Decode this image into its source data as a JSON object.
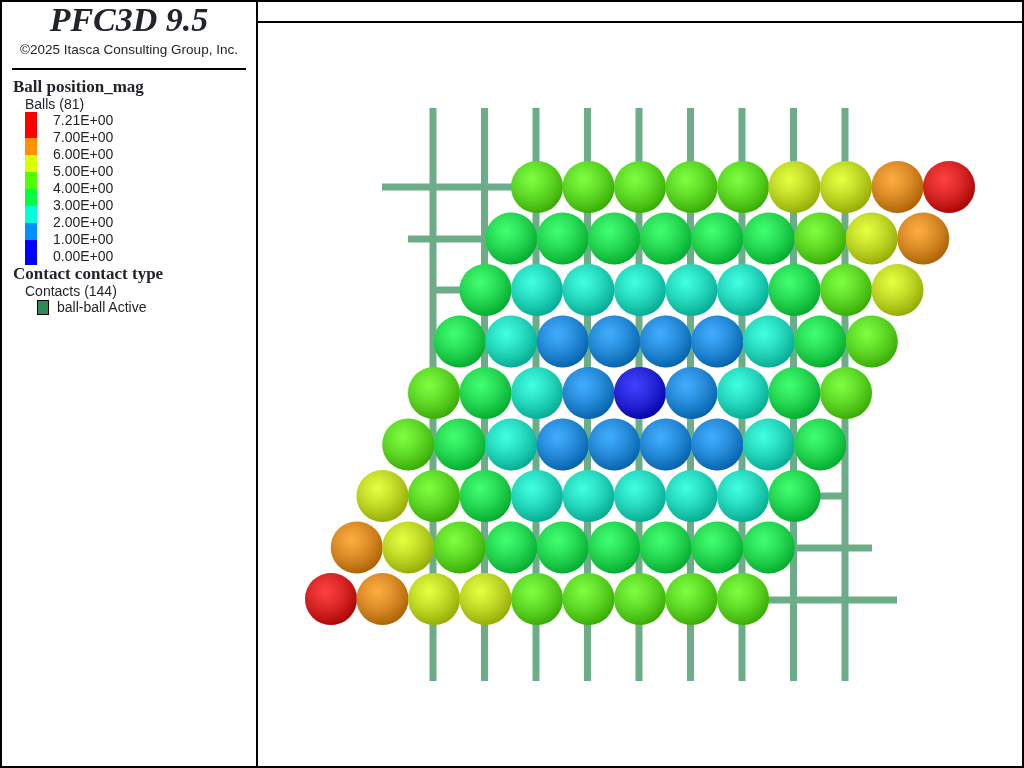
{
  "header": {
    "title": "PFC3D 9.5",
    "copyright": "©2025 Itasca Consulting Group, Inc."
  },
  "legend": [
    {
      "kind": "scale",
      "title": "Ball position_mag",
      "subtitle": "Balls (81)",
      "labels": [
        "7.21E+00",
        "7.00E+00",
        "6.00E+00",
        "5.00E+00",
        "4.00E+00",
        "3.00E+00",
        "2.00E+00",
        "1.00E+00",
        "0.00E+00"
      ],
      "bands": [
        {
          "color": "#ff0000"
        },
        {
          "color": "#ff9000"
        },
        {
          "color": "#dcff00"
        },
        {
          "color": "#50ff00"
        },
        {
          "color": "#00ff40"
        },
        {
          "color": "#00ffd8"
        },
        {
          "color": "#0090ff"
        },
        {
          "color": "#0000ff"
        }
      ]
    },
    {
      "kind": "items",
      "title": "Contact contact type",
      "subtitle": "Contacts (144)",
      "items": [
        {
          "label": "ball-ball Active",
          "color": "#2e8b57"
        }
      ]
    }
  ]
}
